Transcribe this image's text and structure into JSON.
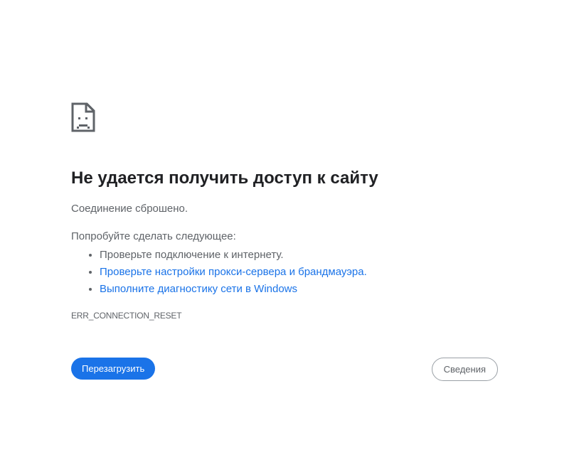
{
  "icon": "sad-page-icon",
  "title": "Не удается получить доступ к сайту",
  "subtitle": "Соединение сброшено.",
  "try_label": "Попробуйте сделать следующее:",
  "suggestions": [
    {
      "text": "Проверьте подключение к интернету.",
      "link": false
    },
    {
      "text": "Проверьте настройки прокси-сервера и брандмауэра.",
      "link": true
    },
    {
      "text": "Выполните диагностику сети в Windows",
      "link": true
    }
  ],
  "error_code": "ERR_CONNECTION_RESET",
  "buttons": {
    "reload_label": "Перезагрузить",
    "details_label": "Сведения"
  },
  "colors": {
    "accent": "#1a73e8",
    "text_primary": "#202124",
    "text_secondary": "#5f6368"
  }
}
